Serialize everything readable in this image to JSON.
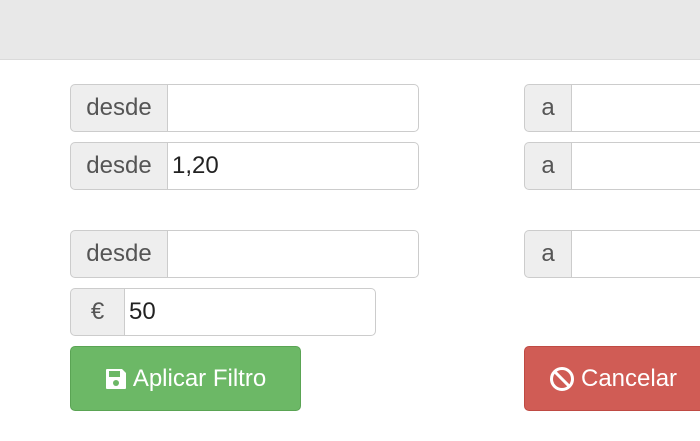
{
  "filters": {
    "range_1": {
      "from_label": "desde",
      "from_value": "",
      "to_label": "a",
      "to_value": ""
    },
    "range_2": {
      "from_label": "desde",
      "from_value": "1,20",
      "to_label": "a",
      "to_value": ""
    },
    "range_3": {
      "from_label": "desde",
      "from_value": "",
      "to_label": "a",
      "to_value": ""
    },
    "price": {
      "currency": "€",
      "value": "50"
    }
  },
  "buttons": {
    "apply_label": "Aplicar Filtro",
    "apply_icon": "floppy-disk-icon",
    "cancel_label": "Cancelar",
    "cancel_icon": "ban-icon"
  },
  "colors": {
    "apply": "#6cb866",
    "cancel": "#d05c55",
    "header": "#e8e8e8"
  }
}
